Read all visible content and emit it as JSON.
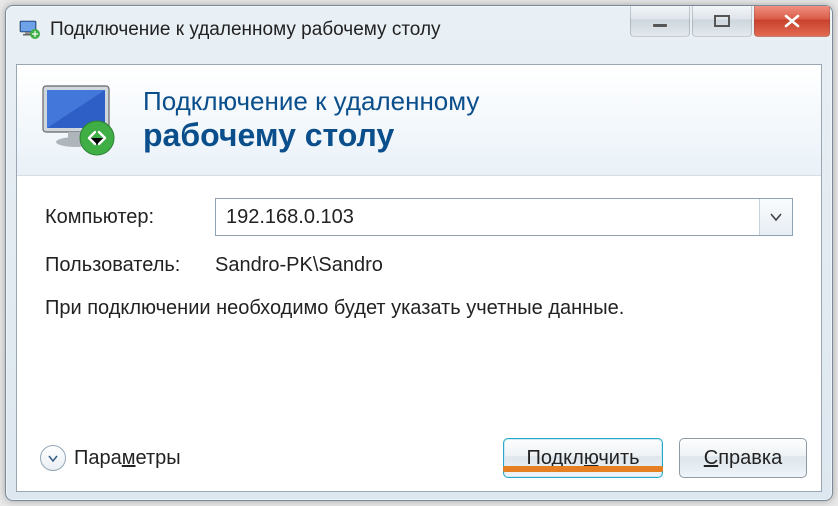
{
  "window": {
    "title": "Подключение к удаленному рабочему столу"
  },
  "header": {
    "line1": "Подключение к удаленному",
    "line2": "рабочему столу"
  },
  "form": {
    "computer_label": "Компьютер:",
    "computer_value": "192.168.0.103",
    "user_label": "Пользователь:",
    "user_value": "Sandro-PK\\Sandro",
    "info_text": "При подключении необходимо будет указать учетные данные."
  },
  "footer": {
    "options_label": "Параметры",
    "connect_label": "Подключить",
    "help_label": "Справка"
  },
  "colors": {
    "accent": "#0a4e8c",
    "close": "#c8412d",
    "highlight": "#e67e22"
  }
}
